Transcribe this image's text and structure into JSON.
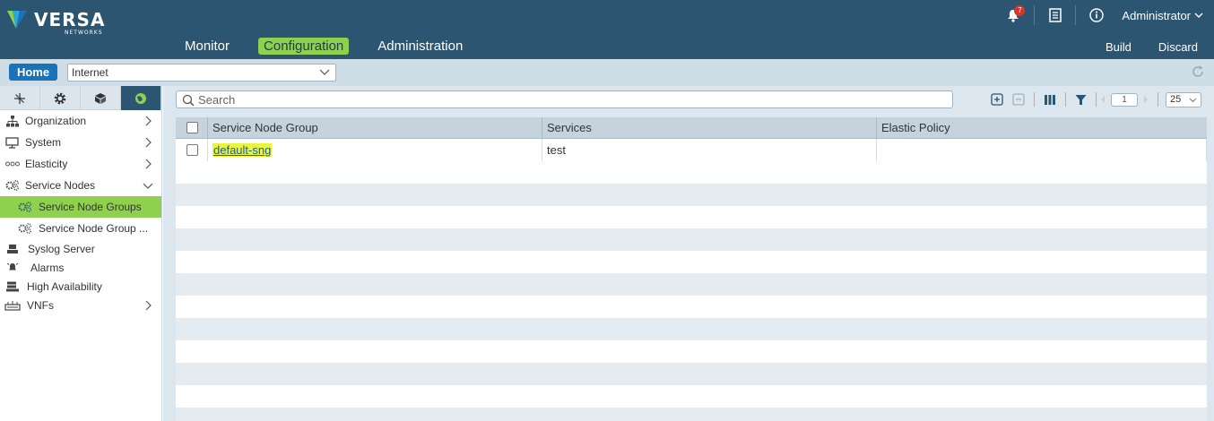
{
  "brand": {
    "name": "VERSA",
    "sub": "NETWORKS"
  },
  "header": {
    "notifications_count": "7",
    "user": "Administrator",
    "nav": [
      {
        "label": "Monitor"
      },
      {
        "label": "Configuration"
      },
      {
        "label": "Administration"
      }
    ],
    "actions": {
      "build": "Build",
      "discard": "Discard"
    }
  },
  "subbar": {
    "home": "Home",
    "organization": "Internet"
  },
  "sidebar": {
    "items": [
      {
        "label": "Organization"
      },
      {
        "label": "System"
      },
      {
        "label": "Elasticity"
      },
      {
        "label": "Service Nodes"
      },
      {
        "label": "Service Node Groups"
      },
      {
        "label": "Service Node Group ..."
      },
      {
        "label": "Syslog Server"
      },
      {
        "label": "Alarms"
      },
      {
        "label": "High Availability"
      },
      {
        "label": "VNFs"
      }
    ]
  },
  "content": {
    "search_placeholder": "Search",
    "page_number": "1",
    "page_size": "25",
    "columns": [
      "Service Node Group",
      "Services",
      "Elastic Policy"
    ],
    "rows": [
      {
        "group": "default-sng",
        "services": "test",
        "policy": ""
      }
    ]
  },
  "colors": {
    "header": "#2c5571",
    "accent": "#8fd14f",
    "home": "#1a72b8"
  }
}
